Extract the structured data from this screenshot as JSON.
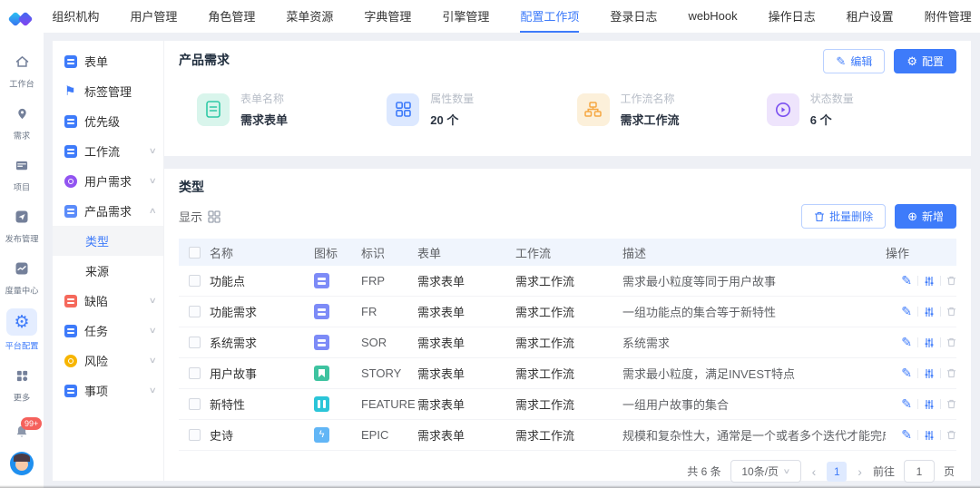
{
  "colors": {
    "accent": "#3e7bfa",
    "badge": "#f5615c",
    "stat_teal": "#2fc9a6",
    "stat_blue": "#3e7bfa",
    "stat_orange": "#f5a742",
    "stat_purple": "#7a4ff0"
  },
  "rail": {
    "items": [
      {
        "label": "工作台",
        "icon": "home-icon"
      },
      {
        "label": "需求",
        "icon": "pin-icon"
      },
      {
        "label": "项目",
        "icon": "project-icon"
      },
      {
        "label": "发布管理",
        "icon": "release-icon"
      },
      {
        "label": "度量中心",
        "icon": "metrics-icon"
      },
      {
        "label": "平台配置",
        "icon": "gear-icon",
        "active": true
      },
      {
        "label": "更多",
        "icon": "more-icon"
      }
    ],
    "notification_badge": "99+"
  },
  "topnav": {
    "items": [
      {
        "label": "组织机构"
      },
      {
        "label": "用户管理"
      },
      {
        "label": "角色管理"
      },
      {
        "label": "菜单资源"
      },
      {
        "label": "字典管理"
      },
      {
        "label": "引擎管理"
      },
      {
        "label": "配置工作项",
        "active": true
      },
      {
        "label": "登录日志"
      },
      {
        "label": "webHook"
      },
      {
        "label": "操作日志"
      },
      {
        "label": "租户设置"
      },
      {
        "label": "附件管理"
      }
    ]
  },
  "sidebar": {
    "items": [
      {
        "label": "表单",
        "icon": "form-icon",
        "color": "#3e7bfa",
        "shape": "sq"
      },
      {
        "label": "标签管理",
        "icon": "flag-icon",
        "color": "#3e7bfa",
        "shape": "flag"
      },
      {
        "label": "优先级",
        "icon": "priority-icon",
        "color": "#3e7bfa",
        "shape": "sq"
      },
      {
        "label": "工作流",
        "icon": "workflow-icon",
        "color": "#3e7bfa",
        "shape": "sq",
        "chevron": "down"
      },
      {
        "label": "用户需求",
        "icon": "user-requirement-icon",
        "color": "#9254f1",
        "shape": "rd",
        "chevron": "down"
      },
      {
        "label": "产品需求",
        "icon": "product-requirement-icon",
        "color": "#5b8cfa",
        "shape": "sq",
        "chevron": "up",
        "children": [
          {
            "label": "类型",
            "active": true
          },
          {
            "label": "来源"
          }
        ]
      },
      {
        "label": "缺陷",
        "icon": "defect-icon",
        "color": "#f5695c",
        "shape": "sq",
        "chevron": "down"
      },
      {
        "label": "任务",
        "icon": "task-icon",
        "color": "#3e7bfa",
        "shape": "sq",
        "chevron": "down"
      },
      {
        "label": "风险",
        "icon": "risk-icon",
        "color": "#f7b500",
        "shape": "rd",
        "chevron": "down"
      },
      {
        "label": "事项",
        "icon": "item-icon",
        "color": "#3e7bfa",
        "shape": "sq",
        "chevron": "down"
      }
    ]
  },
  "panel": {
    "title": "产品需求",
    "edit_label": "编辑",
    "config_label": "配置",
    "stats": [
      {
        "label": "表单名称",
        "value": "需求表单",
        "icon": "form-doc-icon",
        "bg": "#d9f5ec",
        "fg": "#2fc9a6"
      },
      {
        "label": "属性数量",
        "value": "20 个",
        "icon": "attributes-grid-icon",
        "bg": "#dce8ff",
        "fg": "#3e7bfa"
      },
      {
        "label": "工作流名称",
        "value": "需求工作流",
        "icon": "workflow-chart-icon",
        "bg": "#fcf0da",
        "fg": "#f5a742"
      },
      {
        "label": "状态数量",
        "value": "6 个",
        "icon": "status-play-icon",
        "bg": "#eee4fc",
        "fg": "#7a4ff0"
      }
    ]
  },
  "section": {
    "title": "类型",
    "display_label": "显示",
    "batch_delete_label": "批量删除",
    "add_label": "新增",
    "table": {
      "headers": [
        "名称",
        "图标",
        "标识",
        "表单",
        "工作流",
        "描述",
        "操作"
      ],
      "rows": [
        {
          "name": "功能点",
          "icon": {
            "type": "stack",
            "color": "#7d8bf7"
          },
          "code": "FRP",
          "form": "需求表单",
          "workflow": "需求工作流",
          "desc": "需求最小粒度等同于用户故事"
        },
        {
          "name": "功能需求",
          "icon": {
            "type": "stack",
            "color": "#7d8bf7"
          },
          "code": "FR",
          "form": "需求表单",
          "workflow": "需求工作流",
          "desc": "一组功能点的集合等于新特性"
        },
        {
          "name": "系统需求",
          "icon": {
            "type": "stack",
            "color": "#7d8bf7"
          },
          "code": "SOR",
          "form": "需求表单",
          "workflow": "需求工作流",
          "desc": "系统需求"
        },
        {
          "name": "用户故事",
          "icon": {
            "type": "bookmark",
            "color": "#3ec3a0"
          },
          "code": "STORY",
          "form": "需求表单",
          "workflow": "需求工作流",
          "desc": "需求最小粒度，满足INVEST特点"
        },
        {
          "name": "新特性",
          "icon": {
            "type": "columns",
            "color": "#2bc5d8"
          },
          "code": "FEATURE",
          "form": "需求表单",
          "workflow": "需求工作流",
          "desc": "一组用户故事的集合"
        },
        {
          "name": "史诗",
          "icon": {
            "type": "bolt",
            "color": "#62b6f6"
          },
          "code": "EPIC",
          "form": "需求表单",
          "workflow": "需求工作流",
          "desc": "规模和复杂性大，通常是一个或者多个迭代才能完成"
        }
      ]
    },
    "pagination": {
      "total": "共 6 条",
      "page_size": "10条/页",
      "current_page": "1",
      "goto_label": "前往",
      "goto_value": "1",
      "page_unit": "页"
    }
  }
}
